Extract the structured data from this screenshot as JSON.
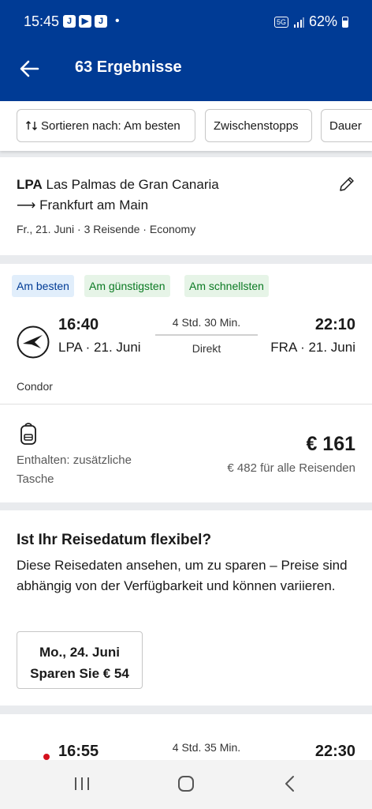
{
  "status": {
    "time": "15:45",
    "notif_icons": [
      "J",
      "▶",
      "J"
    ],
    "network": "5G",
    "battery": "62%"
  },
  "header": {
    "title": "63 Ergebnisse"
  },
  "filters": {
    "sort": "Sortieren nach: Am besten",
    "stops": "Zwischenstopps",
    "duration": "Dauer"
  },
  "search": {
    "origin_code": "LPA",
    "origin_name": "Las Palmas de Gran Canaria",
    "destination": "Frankfurt am Main",
    "arrow": "⟶",
    "details": "Fr., 21. Juni · 3 Reisende · Economy"
  },
  "result1": {
    "tags": [
      "Am besten",
      "Am günstigsten",
      "Am schnellsten"
    ],
    "dep_time": "16:40",
    "dep_airport": "LPA",
    "dep_date": "21. Juni",
    "duration": "4 Std. 30 Min.",
    "stops": "Direkt",
    "arr_time": "22:10",
    "arr_airport": "FRA",
    "arr_date": "21. Juni",
    "airline": "Condor",
    "baggage": "Enthalten: zusätzliche Tasche",
    "price": "€ 161",
    "price_total": "€ 482 für alle Reisenden"
  },
  "flex": {
    "title": "Ist Ihr Reisedatum flexibel?",
    "text": "Diese Reisedaten ansehen, um zu sparen – Preise sind abhängig von der Verfügbarkeit und können variieren.",
    "date": "Mo., 24. Juni",
    "save": "Sparen Sie € 54"
  },
  "result2": {
    "dep_time": "16:55",
    "duration": "4 Std. 35 Min.",
    "arr_time": "22:30"
  },
  "colors": {
    "brand": "#003b95",
    "accent_green": "#0b7a23",
    "accent_blue_bg": "#e1eefb"
  }
}
